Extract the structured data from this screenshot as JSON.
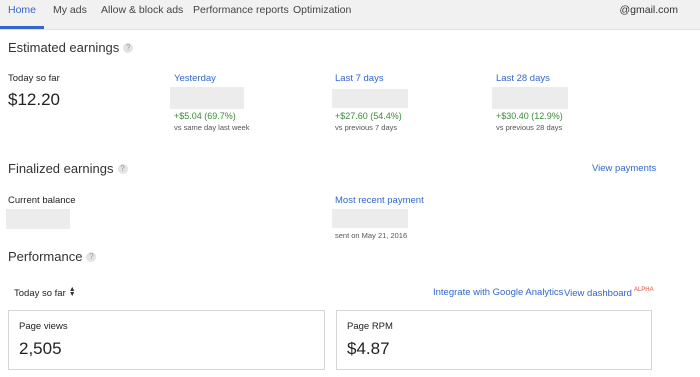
{
  "nav": {
    "tabs": [
      "Home",
      "My ads",
      "Allow & block ads",
      "Performance reports",
      "Optimization"
    ],
    "account": "@gmail.com"
  },
  "estimated": {
    "title": "Estimated earnings",
    "today": {
      "label": "Today so far",
      "value": "$12.20"
    },
    "yesterday": {
      "label": "Yesterday",
      "delta": "+$5.04 (69.7%)",
      "note": "vs same day last week"
    },
    "last7": {
      "label": "Last 7 days",
      "delta": "+$27.60 (54.4%)",
      "note": "vs previous 7 days"
    },
    "last28": {
      "label": "Last 28 days",
      "delta": "+$30.40 (12.9%)",
      "note": "vs previous 28 days"
    }
  },
  "finalized": {
    "title": "Finalized earnings",
    "view_payments": "View payments",
    "balance_label": "Current balance",
    "recent_label": "Most recent payment",
    "sent_on": "sent on May 21, 2016"
  },
  "performance": {
    "title": "Performance",
    "range": "Today so far",
    "integrate": "Integrate with Google Analytics",
    "dashboard": "View dashboard",
    "alpha": "ALPHA",
    "cards": [
      {
        "label": "Page views",
        "value": "2,505"
      },
      {
        "label": "Page RPM",
        "value": "$4.87"
      }
    ]
  },
  "icons": {
    "help": "help-icon",
    "updown": "sort-updown-icon"
  },
  "colors": {
    "link": "#3366cc",
    "positive": "#3a8a3a",
    "alpha": "#dd4b39",
    "nav_bg": "#f1f1f1"
  }
}
